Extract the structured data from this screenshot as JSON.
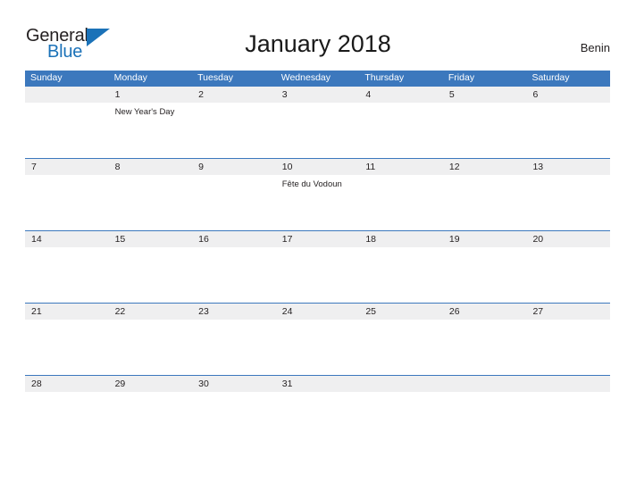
{
  "brand": {
    "name_part1": "General",
    "name_part2": "Blue",
    "triangle_icon": "blue-triangle-icon",
    "accent_color": "#1b72b8"
  },
  "header": {
    "title": "January 2018",
    "country": "Benin"
  },
  "calendar": {
    "header_color": "#3c78bd",
    "date_strip_color": "#efeff0",
    "weekdays": [
      "Sunday",
      "Monday",
      "Tuesday",
      "Wednesday",
      "Thursday",
      "Friday",
      "Saturday"
    ],
    "weeks": [
      {
        "dates": [
          "",
          "1",
          "2",
          "3",
          "4",
          "5",
          "6"
        ],
        "events": [
          "",
          "New Year's Day",
          "",
          "",
          "",
          "",
          ""
        ]
      },
      {
        "dates": [
          "7",
          "8",
          "9",
          "10",
          "11",
          "12",
          "13"
        ],
        "events": [
          "",
          "",
          "",
          "Fête du Vodoun",
          "",
          "",
          ""
        ]
      },
      {
        "dates": [
          "14",
          "15",
          "16",
          "17",
          "18",
          "19",
          "20"
        ],
        "events": [
          "",
          "",
          "",
          "",
          "",
          "",
          ""
        ]
      },
      {
        "dates": [
          "21",
          "22",
          "23",
          "24",
          "25",
          "26",
          "27"
        ],
        "events": [
          "",
          "",
          "",
          "",
          "",
          "",
          ""
        ]
      },
      {
        "dates": [
          "28",
          "29",
          "30",
          "31",
          "",
          "",
          ""
        ],
        "events": [
          "",
          "",
          "",
          "",
          "",
          "",
          ""
        ]
      }
    ]
  }
}
